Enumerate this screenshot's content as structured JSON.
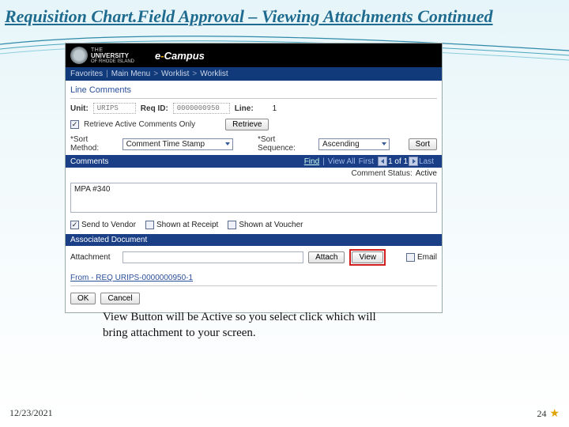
{
  "slide": {
    "title": "Requisition Chart.Field Approval – Viewing Attachments Continued",
    "caption": "View Button will be Active so you select click which will bring attachment to your screen.",
    "date": "12/23/2021",
    "page": "24"
  },
  "uri": {
    "line1": "THE",
    "line2": "UNIVERSITY",
    "line3": "OF RHODE ISLAND"
  },
  "ecampus": {
    "prefix": "e",
    "dash": "-",
    "rest": "Campus"
  },
  "nav": {
    "favorites": "Favorites",
    "mainmenu": "Main Menu",
    "worklist1": "Worklist",
    "worklist2": "Worklist",
    "sep": ">"
  },
  "section": {
    "lineComments": "Line Comments"
  },
  "fields": {
    "unit_lbl": "Unit:",
    "unit_val": "URIPS",
    "reqid_lbl": "Req ID:",
    "reqid_val": "0000000950",
    "line_lbl": "Line:",
    "line_val": "1",
    "retrieve_chk": "Retrieve Active Comments Only",
    "retrieve_btn": "Retrieve",
    "sortmethod_lbl": "*Sort Method:",
    "sortmethod_val": "Comment Time Stamp",
    "sortseq_lbl": "*Sort Sequence:",
    "sortseq_val": "Ascending",
    "sort_btn": "Sort"
  },
  "comments": {
    "bar": "Comments",
    "find": "Find",
    "viewall": "View All",
    "first": "First",
    "page": "1 of 1",
    "last": "Last",
    "status_lbl": "Comment Status:",
    "status_val": "Active",
    "text": "MPA #340"
  },
  "checks": {
    "sendVendor": "Send to Vendor",
    "shownReceipt": "Shown at Receipt",
    "shownVoucher": "Shown at Voucher"
  },
  "assoc": {
    "bar": "Associated Document",
    "attachment_lbl": "Attachment",
    "attach_btn": "Attach",
    "view_btn": "View",
    "email_lbl": "Email"
  },
  "from_link": "From - REQ URIPS-0000000950-1",
  "footer": {
    "ok": "OK",
    "cancel": "Cancel"
  }
}
